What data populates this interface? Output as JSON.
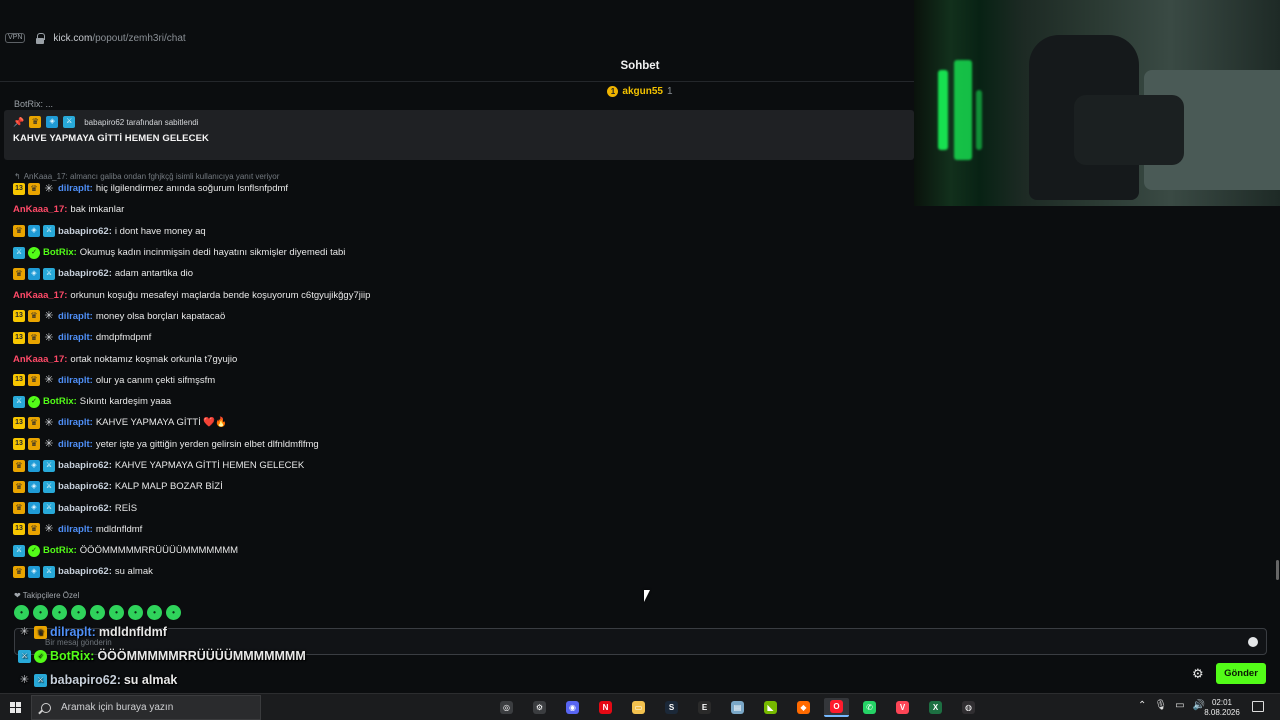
{
  "browser": {
    "vpn_label": "VPN",
    "url_host": "kick.com",
    "url_path": "/popout/zemh3ri/chat"
  },
  "chat": {
    "title": "Sohbet",
    "top_gifter": {
      "rank": "1",
      "name": "akgun55",
      "count": "1"
    },
    "cut_line": "BotRix: ...",
    "pinned": {
      "pinned_by": "babapiro62 tarafından sabitlendi",
      "message": "KAHVE YAPMAYA GİTTİ HEMEN GELECEK"
    },
    "reply_context": "AnKaaa_17: almancı galiba ondan fghjkçğ isimli kullanıcıya yanıt veriyor",
    "messages": [
      {
        "badges": [
          "sub",
          "crown",
          "star"
        ],
        "user": "dilraplt",
        "user_class": "u-dilrap",
        "text": "hiç ilgilendirmez anında soğurum lsnflsnfpdmf"
      },
      {
        "badges": [],
        "user": "AnKaaa_17",
        "user_class": "u-ankaaa",
        "text": "bak imkanlar"
      },
      {
        "badges": [
          "crown",
          "vip",
          "mod"
        ],
        "user": "babapiro62",
        "user_class": "u-baba",
        "text": "i dont have money aq"
      },
      {
        "badges": [
          "mod",
          "verified"
        ],
        "user": "BotRix",
        "user_class": "u-botrix",
        "text": "Okumuş kadın incinmişsin dedi hayatını sikmişler diyemedi tabi"
      },
      {
        "badges": [
          "crown",
          "vip",
          "mod"
        ],
        "user": "babapiro62",
        "user_class": "u-baba",
        "text": "adam antartika dio"
      },
      {
        "badges": [],
        "user": "AnKaaa_17",
        "user_class": "u-ankaaa",
        "text": "orkunun koşuğu mesafeyi maçlarda bende koşuyorum c6tgyujikğgy7jiip"
      },
      {
        "badges": [
          "sub",
          "crown",
          "star"
        ],
        "user": "dilraplt",
        "user_class": "u-dilrap",
        "text": "money olsa borçları kapatacaö"
      },
      {
        "badges": [
          "sub",
          "crown",
          "star"
        ],
        "user": "dilraplt",
        "user_class": "u-dilrap",
        "text": "dmdpfmdpmf"
      },
      {
        "badges": [],
        "user": "AnKaaa_17",
        "user_class": "u-ankaaa",
        "text": "ortak noktamız koşmak orkunla t7gyujio"
      },
      {
        "badges": [
          "sub",
          "crown",
          "star"
        ],
        "user": "dilraplt",
        "user_class": "u-dilrap",
        "text": "olur ya canım çekti sifmşsfm"
      },
      {
        "badges": [
          "mod",
          "verified"
        ],
        "user": "BotRix",
        "user_class": "u-botrix",
        "text": "Sıkıntı kardeşim yaaa"
      },
      {
        "badges": [
          "sub",
          "crown",
          "star"
        ],
        "user": "dilraplt",
        "user_class": "u-dilrap",
        "text": "KAHVE YAPMAYA GİTTİ ❤️🔥"
      },
      {
        "badges": [
          "sub",
          "crown",
          "star"
        ],
        "user": "dilraplt",
        "user_class": "u-dilrap",
        "text": "yeter işte ya gittiğin yerden gelirsin elbet dlfnldmflfmg"
      },
      {
        "badges": [
          "crown",
          "vip",
          "mod"
        ],
        "user": "babapiro62",
        "user_class": "u-baba",
        "text": "KAHVE YAPMAYA GİTTİ HEMEN GELECEK"
      },
      {
        "badges": [
          "crown",
          "vip",
          "mod"
        ],
        "user": "babapiro62",
        "user_class": "u-baba",
        "text": "KALP MALP BOZAR BİZİ"
      },
      {
        "badges": [
          "crown",
          "vip",
          "mod"
        ],
        "user": "babapiro62",
        "user_class": "u-baba",
        "text": "REİS"
      },
      {
        "badges": [
          "sub",
          "crown",
          "star"
        ],
        "user": "dilraplt",
        "user_class": "u-dilrap",
        "text": "mdldnfldmf"
      },
      {
        "badges": [
          "mod",
          "verified"
        ],
        "user": "BotRix",
        "user_class": "u-botrix",
        "text": "ÖÖÖMMMMMRRÜÜÜÜMMMMMMM"
      },
      {
        "badges": [
          "crown",
          "vip",
          "mod"
        ],
        "user": "babapiro62",
        "user_class": "u-baba",
        "text": "su almak"
      }
    ],
    "followers_label": "Takipçilere Özel",
    "emotes": [
      "cat-emote",
      "green-emote",
      "red-emote",
      "alien-emote",
      "green-blob-emote",
      "green-skull-emote",
      "green-alien-emote",
      "monkey-emote",
      "green-face-emote"
    ],
    "input_placeholder": "Bir mesaj gönderin",
    "send_label": "Gönder"
  },
  "overlay": [
    {
      "badges": [
        "star",
        "crown"
      ],
      "user": "dilraplt",
      "user_class": "u-dilrap",
      "text": "mdldnfldmf"
    },
    {
      "badges": [
        "mod",
        "verified"
      ],
      "user": "BotRix",
      "user_class": "u-botrix",
      "text": "ÖÖÖMMMMMRRÜÜÜÜMMMMMMM"
    },
    {
      "badges": [
        "star",
        "mod"
      ],
      "user": "babapiro62",
      "user_class": "u-baba",
      "text": "su almak"
    }
  ],
  "taskbar": {
    "search_placeholder": "Aramak için buraya yazın",
    "apps": [
      {
        "name": "steelseries-icon",
        "glyph": "◎",
        "color": "#3b3d40"
      },
      {
        "name": "settings-icon",
        "glyph": "⚙",
        "color": "#3b3d40"
      },
      {
        "name": "discord-icon",
        "glyph": "◉",
        "color": "#5865f2"
      },
      {
        "name": "netflix-icon",
        "glyph": "N",
        "color": "#e50914"
      },
      {
        "name": "file-explorer-icon",
        "glyph": "▭",
        "color": "#f2c14e"
      },
      {
        "name": "steam-icon",
        "glyph": "S",
        "color": "#1b2838"
      },
      {
        "name": "epic-games-icon",
        "glyph": "E",
        "color": "#2a2a2a"
      },
      {
        "name": "notepad-icon",
        "glyph": "▤",
        "color": "#7aa7c7"
      },
      {
        "name": "nvidia-icon",
        "glyph": "◣",
        "color": "#76b900"
      },
      {
        "name": "orange-app-icon",
        "glyph": "◆",
        "color": "#ff6a00"
      },
      {
        "name": "opera-icon",
        "glyph": "O",
        "color": "#ff1b2d"
      },
      {
        "name": "whatsapp-icon",
        "glyph": "✆",
        "color": "#25d366"
      },
      {
        "name": "valorant-icon",
        "glyph": "V",
        "color": "#fd4556"
      },
      {
        "name": "excel-icon",
        "glyph": "X",
        "color": "#1d6f42"
      },
      {
        "name": "obs-icon",
        "glyph": "◍",
        "color": "#302e31"
      }
    ],
    "clock_time": "02:01",
    "clock_date": "8.08.2026"
  }
}
